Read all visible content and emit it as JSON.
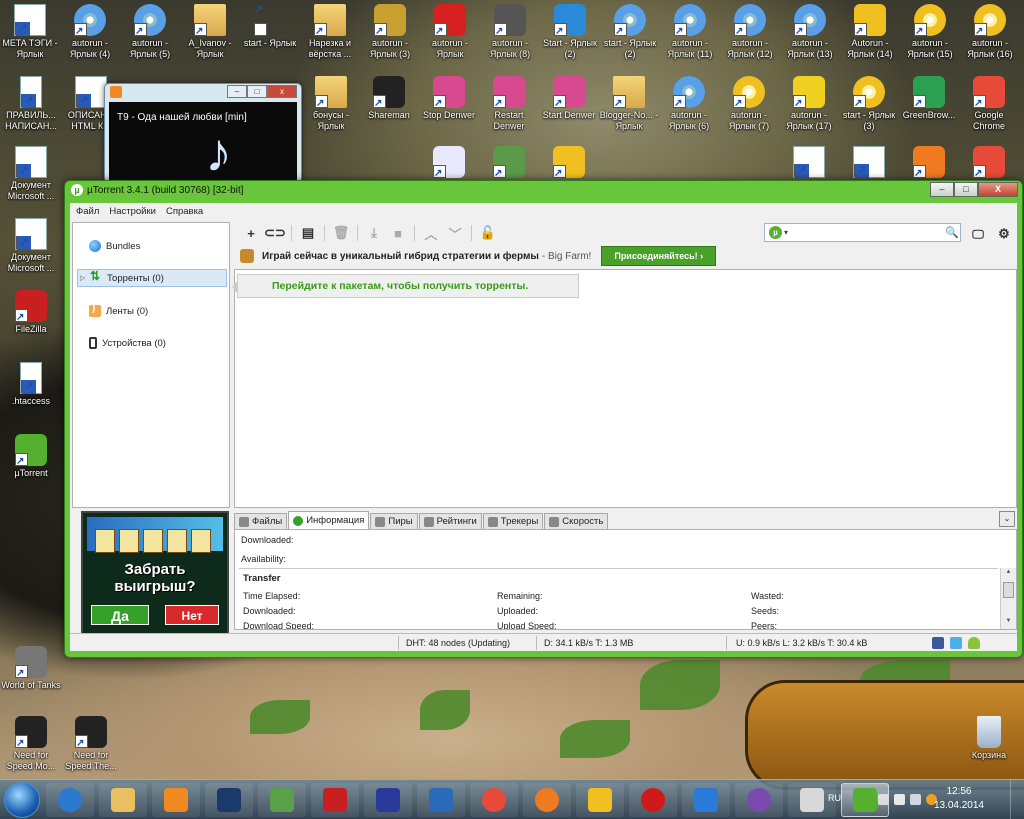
{
  "desktop": {
    "icons_row1": [
      {
        "label": "META ТЭГИ - Ярлык",
        "icon": "word-doc-icon"
      },
      {
        "label": "autorun - Ярлык (4)",
        "icon": "cd-icon"
      },
      {
        "label": "autorun - Ярлык (5)",
        "icon": "cd-icon"
      },
      {
        "label": "A_Ivanov - Ярлык",
        "icon": "folder-icon"
      },
      {
        "label": "start - Ярлык",
        "icon": "wrench-icon"
      },
      {
        "label": "Нарезка и вёрстка ...",
        "icon": "folder-icon"
      },
      {
        "label": "autorun - Ярлык (3)",
        "icon": "compass-icon"
      },
      {
        "label": "autorun - Ярлык",
        "icon": "h-icon"
      },
      {
        "label": "autorun - Ярлык (8)",
        "icon": "gear-icon"
      },
      {
        "label": "Start - Ярлык (2)",
        "icon": "c-icon"
      },
      {
        "label": "start - Ярлык (2)",
        "icon": "cd-icon"
      },
      {
        "label": "autorun - Ярлык (11)",
        "icon": "cd-icon"
      },
      {
        "label": "autorun - Ярлык (12)",
        "icon": "cd-icon"
      },
      {
        "label": "autorun - Ярлык (13)",
        "icon": "cd-icon"
      },
      {
        "label": "Autorun - Ярлык (14)",
        "icon": "lightning-icon"
      },
      {
        "label": "autorun - Ярлык (15)",
        "icon": "cd-yellow-icon"
      },
      {
        "label": "autorun - Ярлык (16)",
        "icon": "cd-yellow-icon"
      }
    ],
    "icons_row2": [
      {
        "label": "ПРАВИЛЬ... НАПИСАН...",
        "icon": "doc-icon"
      },
      {
        "label": "ОПИСАН... HTML К...",
        "icon": "word-doc-icon"
      },
      {
        "label": "бонусы - Ярлык",
        "icon": "folder-music-icon"
      },
      {
        "label": "Shareman",
        "icon": "penguin-icon"
      },
      {
        "label": "Stop Denwer",
        "icon": "denwer-icon"
      },
      {
        "label": "Restart Denwer",
        "icon": "denwer-icon"
      },
      {
        "label": "Start Denwer",
        "icon": "denwer-icon"
      },
      {
        "label": "Blogger-No... - Ярлык",
        "icon": "folder-icon"
      },
      {
        "label": "autorun - Ярлык (6)",
        "icon": "cd-icon"
      },
      {
        "label": "autorun - Ярлык (7)",
        "icon": "cd-yellow-icon"
      },
      {
        "label": "autorun - Ярлык (17)",
        "icon": "star-icon"
      },
      {
        "label": "start - Ярлык (3)",
        "icon": "cd-yellow-icon"
      },
      {
        "label": "GreenBrow...",
        "icon": "greenbrowser-icon"
      },
      {
        "label": "Google Chrome",
        "icon": "chrome-icon"
      }
    ],
    "icons_row3": [
      {
        "label": "",
        "icon": "abc-icon"
      },
      {
        "label": "",
        "icon": "chart-doc-icon"
      },
      {
        "label": "",
        "icon": "yellow-face-icon"
      },
      {
        "label": "",
        "icon": "word-doc-icon"
      },
      {
        "label": "",
        "icon": "word-doc-icon"
      },
      {
        "label": "",
        "icon": "firefox-icon"
      },
      {
        "label": "",
        "icon": "chrome-icon"
      }
    ],
    "left_icons": [
      {
        "label": "Документ Microsoft ...",
        "icon": "word-doc-icon"
      },
      {
        "label": "Документ Microsoft ...",
        "icon": "word-doc-icon"
      },
      {
        "label": "FileZilla",
        "icon": "filezilla-icon"
      },
      {
        "label": ".htaccess",
        "icon": "file-icon"
      },
      {
        "label": "µTorrent",
        "icon": "utorrent-icon"
      },
      {
        "label": "World of Tanks",
        "icon": "wot-icon"
      },
      {
        "label": "Need for Speed Mo...",
        "icon": "nfs-icon"
      },
      {
        "label": "Need for Speed The...",
        "icon": "nfs-icon"
      }
    ],
    "recycle_bin": "Корзина"
  },
  "media_player": {
    "track": "T9 - Ода нашей любви [min]"
  },
  "utorrent": {
    "title": "µTorrent 3.4.1  (build 30768) [32-bit]",
    "window_buttons": {
      "minimize": "–",
      "maximize": "□",
      "close": "X"
    },
    "menu": [
      "Файл",
      "Настройки",
      "Справка"
    ],
    "sidebar": [
      {
        "label": "Bundles",
        "icon": "bundles-icon"
      },
      {
        "label": "Торренты (0)",
        "icon": "torrents-icon"
      },
      {
        "label": "Ленты (0)",
        "icon": "rss-icon"
      },
      {
        "label": "Устройства (0)",
        "icon": "device-icon"
      }
    ],
    "ad": {
      "title": "Забрать выигрыш?",
      "yes": "Да",
      "no": "Нет"
    },
    "toolbar": {
      "icons": [
        "add-torrent-icon",
        "add-link-icon",
        "create-torrent-icon",
        "delete-icon",
        "download-icon",
        "stop-icon",
        "move-up-icon",
        "move-down-icon",
        "unlock-icon"
      ],
      "search_placeholder": ""
    },
    "promo": {
      "text": "Играй сейчас в уникальный гибрид стратегии и фермы",
      "source": "- Big Farm!",
      "button": "Присоединяйтесь! ›"
    },
    "bundles_hint": "Перейдите к пакетам, чтобы получить торренты.",
    "tabs": [
      "Файлы",
      "Информация",
      "Пиры",
      "Рейтинги",
      "Трекеры",
      "Скорость"
    ],
    "active_tab": "Информация",
    "info": {
      "downloaded_label": "Downloaded:",
      "availability_label": "Availability:",
      "transfer_header": "Transfer",
      "col1": [
        "Time Elapsed:",
        "Downloaded:",
        "Download Speed:"
      ],
      "col2": [
        "Remaining:",
        "Uploaded:",
        "Upload Speed:"
      ],
      "col3": [
        "Wasted:",
        "Seeds:",
        "Peers:"
      ]
    },
    "status": {
      "dht": "DHT: 48 nodes (Updating)",
      "down": "D: 34.1 kB/s T: 1.3 MB",
      "up": "U: 0.9 kB/s L: 3.2 kB/s T: 30.4 kB"
    }
  },
  "taskbar": {
    "apps": [
      "windows-explorer-icon",
      "ie-icon",
      "explorer-folder-icon",
      "media-player-icon",
      "photoshop-icon",
      "notepad-chart-icon",
      "filezilla-icon",
      "save-icon",
      "thunderbird-icon",
      "chrome-icon",
      "firefox-icon",
      "yandex-icon",
      "opera-icon",
      "maxthon-icon",
      "tor-icon",
      "paint-icon",
      "utorrent-icon"
    ],
    "lang": "RU",
    "time": "12:56",
    "date": "13.04.2014",
    "colors": {
      "utorrent_green": "#69c63a",
      "promo_button": "#4aa12a",
      "hint_text": "#3a9a1a"
    }
  }
}
